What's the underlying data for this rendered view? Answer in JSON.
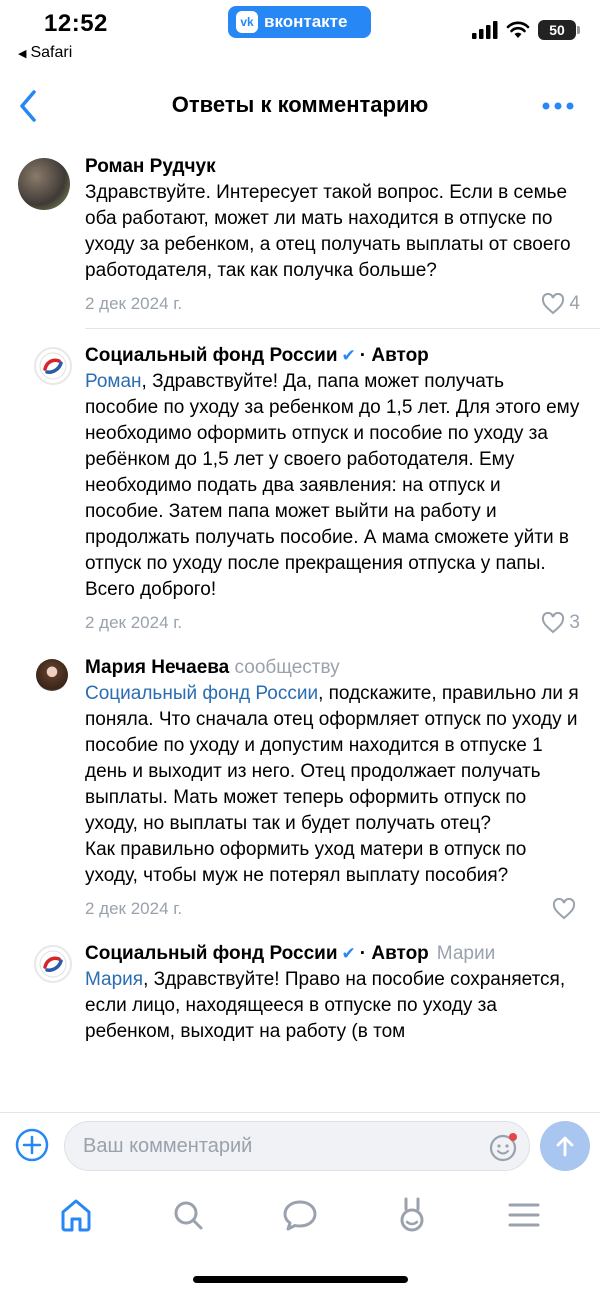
{
  "status": {
    "time": "12:52",
    "back_app": "Safari",
    "app_badge": "вконтакте",
    "battery": "50"
  },
  "header": {
    "title": "Ответы к комментарию"
  },
  "comments": [
    {
      "author": "Роман Рудчук",
      "text": "Здравствуйте. Интересует такой вопрос. Если в семье оба работают, может ли мать находится в отпуске по уходу за ребенком, а отец получать выплаты от своего работодателя, так как получка больше?",
      "date": "2 дек 2024 г.",
      "likes": "4"
    },
    {
      "author": "Социальный фонд России",
      "role": "· Автор",
      "mention": "Роман",
      "text": ", Здравствуйте! Да, папа может получать пособие по уходу за ребенком до 1,5 лет. Для этого ему необходимо оформить отпуск и пособие по уходу за ребёнком до 1,5 лет у своего работодателя. Ему необходимо подать два заявления: на отпуск и пособие. Затем папа может выйти на работу и продолжать получать пособие. А мама сможете уйти в отпуск по уходу после прекращения отпуска у папы. Всего доброго!",
      "date": "2 дек 2024 г.",
      "likes": "3"
    },
    {
      "author": "Мария Нечаева",
      "badge": "сообществу",
      "mention": "Социальный фонд России",
      "text": ", подскажите, правильно ли я поняла. Что сначала отец оформляет отпуск по уходу и пособие по уходу и допустим находится в отпуске 1 день и выходит из него. Отец продолжает получать выплаты. Мать может теперь оформить отпуск по уходу, но выплаты так и будет получать отец?\nКак правильно оформить уход матери в отпуск по уходу, чтобы муж не потерял выплату пособия?",
      "date": "2 дек 2024 г.",
      "likes": ""
    },
    {
      "author": "Социальный фонд России",
      "role": "· Автор",
      "reply_to": "Марии",
      "mention": "Мария",
      "text": ", Здравствуйте! Право на пособие сохраняется, если лицо, находящееся в отпуске по уходу за ребенком, выходит на работу (в том"
    }
  ],
  "composer": {
    "placeholder": "Ваш комментарий"
  },
  "tabbar": {
    "items": [
      "home-icon",
      "search-icon",
      "messages-icon",
      "clips-icon",
      "menu-icon"
    ]
  },
  "colors": {
    "accent": "#2787f5",
    "link": "#2a6db2",
    "secondary_text": "#99a2ad"
  }
}
